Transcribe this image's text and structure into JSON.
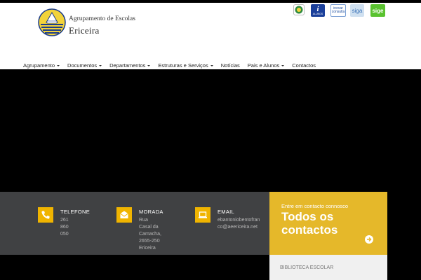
{
  "header": {
    "brand_small": "Agrupamento de Escolas",
    "brand_big": "Ericeira",
    "logo_icon": "school-crest-icon",
    "badges": [
      {
        "name": "partner-badge-seal",
        "label": ""
      },
      {
        "name": "partner-badge-i-alunos",
        "label_main": "i",
        "label_sub": "ALUNOS"
      },
      {
        "name": "partner-badge-inovar-consulta",
        "line1": "inovar",
        "line2": "consulta"
      },
      {
        "name": "partner-badge-siga",
        "label": "siga"
      },
      {
        "name": "partner-badge-sige",
        "label": "sige"
      }
    ]
  },
  "nav": {
    "items": [
      {
        "label": "Agrupamento",
        "dropdown": true
      },
      {
        "label": "Documentos",
        "dropdown": true
      },
      {
        "label": "Departamentos",
        "dropdown": true
      },
      {
        "label": "Estruturas e Serviços",
        "dropdown": true
      },
      {
        "label": "Notícias",
        "dropdown": false
      },
      {
        "label": "Pais e Alunos",
        "dropdown": true
      },
      {
        "label": "Contactos",
        "dropdown": false
      }
    ]
  },
  "contacts": {
    "phone": {
      "title": "TELEFONE",
      "text": "261 860 050",
      "icon": "phone-icon"
    },
    "address": {
      "title": "MORADA",
      "line1": "Rua Casal da",
      "line2": "Camacha,",
      "line3": "2655-250 Ericeira",
      "icon": "envelope-icon"
    },
    "email": {
      "title": "EMAIL",
      "line1": "ebantoniobentofran",
      "line2": "co@aeericeira.net",
      "icon": "laptop-icon"
    }
  },
  "cta": {
    "small": "Entre em contacto connosco",
    "line1": "Todos os",
    "line2": "contactos",
    "arrow_icon": "arrow-right-circle-icon"
  },
  "biblioteca": {
    "label": "BIBLIOTECA ESCOLAR"
  },
  "colors": {
    "accent": "#e5b82a",
    "icon_bg": "#f0b400",
    "dark_bar": "#404143"
  }
}
